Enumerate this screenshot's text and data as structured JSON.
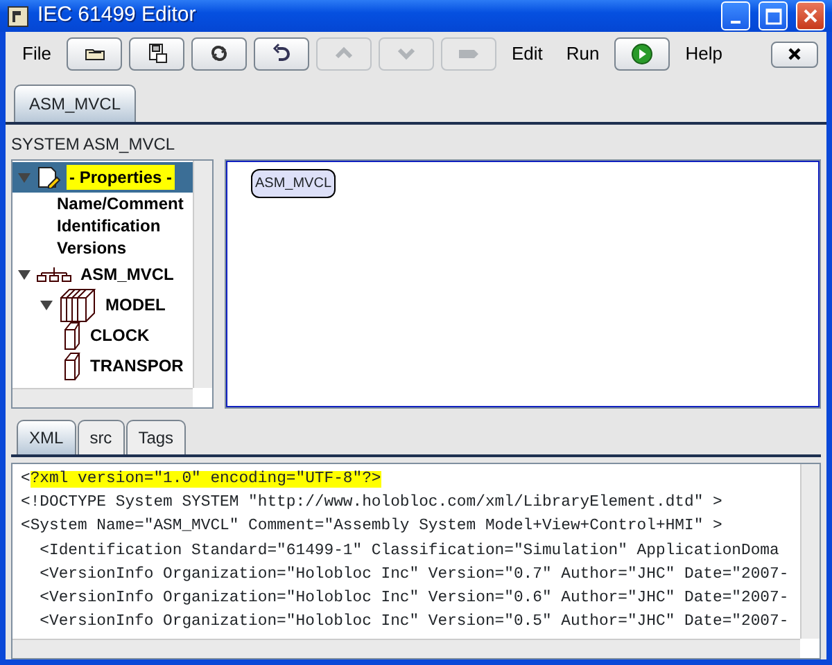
{
  "window": {
    "title": "IEC 61499 Editor"
  },
  "toolbar": [
    {
      "kind": "menu",
      "label": "File"
    },
    {
      "kind": "button",
      "disabled": false
    },
    {
      "kind": "button",
      "disabled": false
    },
    {
      "kind": "button",
      "disabled": false
    },
    {
      "kind": "button",
      "disabled": false
    },
    {
      "kind": "button",
      "disabled": true
    },
    {
      "kind": "button",
      "disabled": true
    },
    {
      "kind": "button",
      "disabled": true
    },
    {
      "kind": "menu",
      "label": "Edit"
    },
    {
      "kind": "menu",
      "label": "Run"
    },
    {
      "kind": "button",
      "disabled": false
    },
    {
      "kind": "menu",
      "label": "Help"
    },
    {
      "kind": "close",
      "disabled": false
    }
  ],
  "document_tabs": [
    {
      "label": "ASM_MVCL",
      "selected": true
    }
  ],
  "system_label": "SYSTEM ASM_MVCL",
  "tree": [
    {
      "kind": "properties",
      "label": "- Properties -",
      "selected": true,
      "expanded": true,
      "children": [
        {
          "kind": "entry",
          "label": "Name/Comment",
          "selected": false
        },
        {
          "kind": "entry",
          "label": "Identification",
          "selected": false
        },
        {
          "kind": "entry",
          "label": "Versions",
          "selected": false
        }
      ]
    },
    {
      "kind": "system",
      "label": "ASM_MVCL",
      "selected": false,
      "expanded": true,
      "children": [
        {
          "kind": "resource",
          "label": "MODEL",
          "selected": false,
          "expanded": true,
          "children": [
            {
              "kind": "block",
              "label": "CLOCK",
              "selected": false
            },
            {
              "kind": "block",
              "label": "TRANSPOR",
              "selected": false
            }
          ]
        }
      ]
    }
  ],
  "canvas": {
    "nodes": [
      {
        "label": "ASM_MVCL"
      }
    ]
  },
  "bottom_tabs": [
    {
      "label": "XML",
      "selected": true
    },
    {
      "label": "src",
      "selected": false
    },
    {
      "label": "Tags",
      "selected": false
    }
  ],
  "xml_lines": [
    {
      "parts": [
        {
          "text": "<",
          "highlighted": false
        },
        {
          "text": "?xml version=\"1.0\" encoding=\"UTF-8\"?>",
          "highlighted": true
        }
      ]
    },
    {
      "parts": [
        {
          "text": "<!DOCTYPE System SYSTEM \"http://www.holobloc.com/xml/LibraryElement.dtd\" >",
          "highlighted": false
        }
      ]
    },
    {
      "parts": [
        {
          "text": "<System Name=\"ASM_MVCL\" Comment=\"Assembly System Model+View+Control+HMI\" >",
          "highlighted": false
        }
      ]
    },
    {
      "parts": [
        {
          "text": "  <Identification Standard=\"61499-1\" Classification=\"Simulation\" ApplicationDoma",
          "highlighted": false
        }
      ]
    },
    {
      "parts": [
        {
          "text": "  <VersionInfo Organization=\"Holobloc Inc\" Version=\"0.7\" Author=\"JHC\" Date=\"2007-",
          "highlighted": false
        }
      ]
    },
    {
      "parts": [
        {
          "text": "  <VersionInfo Organization=\"Holobloc Inc\" Version=\"0.6\" Author=\"JHC\" Date=\"2007-",
          "highlighted": false
        }
      ]
    },
    {
      "parts": [
        {
          "text": "  <VersionInfo Organization=\"Holobloc Inc\" Version=\"0.5\" Author=\"JHC\" Date=\"2007-",
          "highlighted": false
        }
      ]
    }
  ]
}
